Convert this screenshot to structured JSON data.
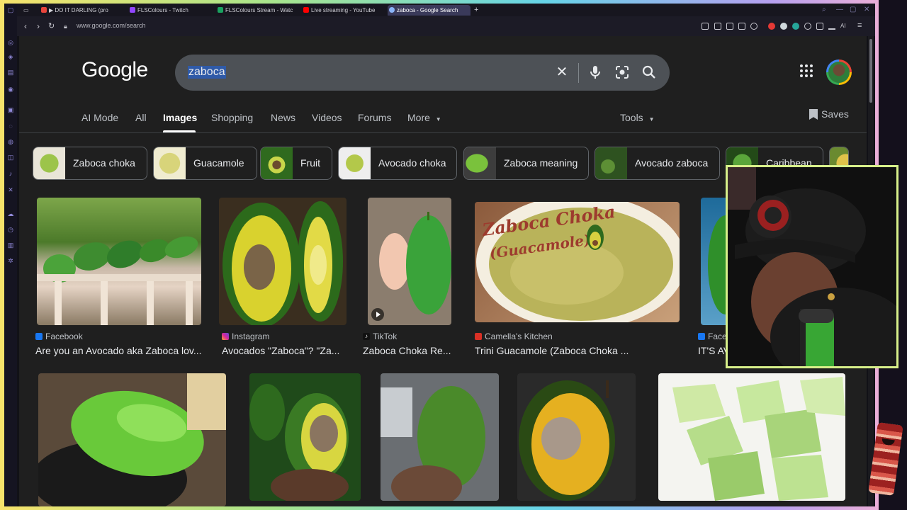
{
  "browser": {
    "tabs": [
      {
        "label": "▶ DO IT DARLING (pro",
        "color": "#e8453c"
      },
      {
        "label": "FLSColours - Twitch",
        "color": "#9146ff"
      },
      {
        "label": "FLSColours Stream - Watc",
        "color": "#1aa260"
      },
      {
        "label": "Live streaming - YouTube",
        "color": "#ff0000"
      },
      {
        "label": "zaboca - Google Search",
        "color": "#8ab4f8"
      }
    ],
    "new_tab": "+",
    "url": "www.google.com/search",
    "ai_label": "AI"
  },
  "google": {
    "logo": "Google",
    "query": "zaboca",
    "tabs": [
      "AI Mode",
      "All",
      "Images",
      "Shopping",
      "News",
      "Videos",
      "Forums",
      "More"
    ],
    "active_tab": "Images",
    "tools_label": "Tools",
    "saves_label": "Saves",
    "chips": [
      {
        "label": "Zaboca choka"
      },
      {
        "label": "Guacamole"
      },
      {
        "label": "Fruit"
      },
      {
        "label": "Avocado choka"
      },
      {
        "label": "Zaboca meaning"
      },
      {
        "label": "Avocado zaboca"
      },
      {
        "label": "Caribbean"
      }
    ],
    "results": [
      {
        "source": "Facebook",
        "caption": "Are you an Avocado aka Zaboca lov...",
        "source_color": "#1877f2"
      },
      {
        "source": "Instagram",
        "caption": "Avocados \"Zaboca\"? \"Za...",
        "source_color": "#d6249f"
      },
      {
        "source": "TikTok",
        "caption": "Zaboca Choka Re...",
        "source_color": "#111111"
      },
      {
        "source": "Camella's Kitchen",
        "caption": "Trini Guacamole (Zaboca Choka ...",
        "source_color": "#d93025"
      },
      {
        "source": "Face",
        "caption": "IT'S AV",
        "source_color": "#1877f2"
      }
    ],
    "thumbnail_texts": {
      "choka_overlay": "Zaboca Choka (Guacamole)"
    }
  }
}
